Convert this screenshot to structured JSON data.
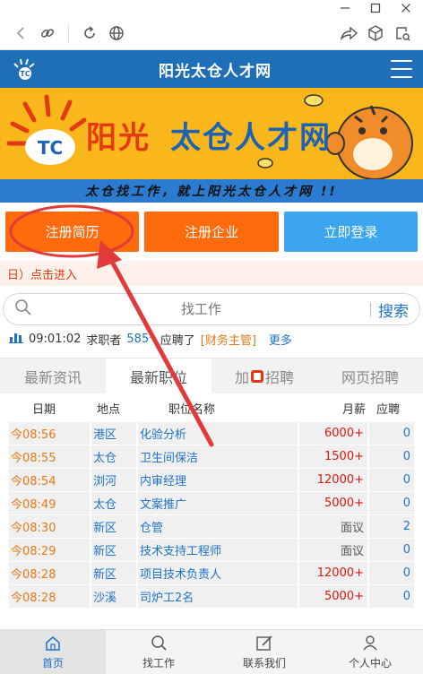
{
  "site": {
    "title": "阳光太仓人才网",
    "banner_brand_part1": "阳光",
    "banner_brand_part2": "太仓人才网",
    "banner_slogan": "太仓找工作，就上阳光太仓人才网 !!"
  },
  "actions": {
    "register_resume": "注册简历",
    "register_company": "注册企业",
    "login": "立即登录"
  },
  "notice": {
    "text": "日）点击进入"
  },
  "search": {
    "placeholder": "找工作",
    "button": "搜索"
  },
  "ticker": {
    "time": "09:01:02",
    "seeker_label": "求职者",
    "seeker_id": "585*",
    "action": "应聘了",
    "job": "[财务主管]",
    "more": "更多"
  },
  "tabs": [
    {
      "label": "最新资讯"
    },
    {
      "label": "最新职位"
    },
    {
      "label_pre": "加",
      "label_post": "招聘"
    },
    {
      "label": "网页招聘"
    }
  ],
  "jobs": {
    "headers": {
      "date": "日期",
      "location": "地点",
      "title": "职位名称",
      "salary": "月薪",
      "applied": "应聘"
    },
    "rows": [
      {
        "date": "今08:56",
        "location": "港区",
        "title": "化验分析",
        "salary": "6000+",
        "applied": "0"
      },
      {
        "date": "今08:55",
        "location": "太仓",
        "title": "卫生间保洁",
        "salary": "1500+",
        "applied": "0"
      },
      {
        "date": "今08:54",
        "location": "浏河",
        "title": "内审经理",
        "salary": "12000+",
        "applied": "0"
      },
      {
        "date": "今08:49",
        "location": "太仓",
        "title": "文案推广",
        "salary": "5000+",
        "applied": "0"
      },
      {
        "date": "今08:30",
        "location": "新区",
        "title": "仓管",
        "salary": "面议",
        "applied": "2"
      },
      {
        "date": "今08:29",
        "location": "新区",
        "title": "技术支持工程师",
        "salary": "面议",
        "applied": "0"
      },
      {
        "date": "今08:28",
        "location": "新区",
        "title": "项目技术负责人",
        "salary": "12000+",
        "applied": "0"
      },
      {
        "date": "今08:28",
        "location": "沙溪",
        "title": "司炉工2名",
        "salary": "5000+",
        "applied": "0"
      }
    ]
  },
  "bottom_nav": [
    {
      "label": "首页",
      "icon": "home-icon"
    },
    {
      "label": "找工作",
      "icon": "search-icon"
    },
    {
      "label": "联系我们",
      "icon": "edit-icon"
    },
    {
      "label": "个人中心",
      "icon": "user-icon"
    }
  ],
  "colors": {
    "header_blue": "#1e6fb7",
    "banner_yellow": "#f9b71b",
    "action_orange": "#ff6a0c",
    "action_blue": "#3ba6ef",
    "annotation_red": "#e23a3a"
  }
}
